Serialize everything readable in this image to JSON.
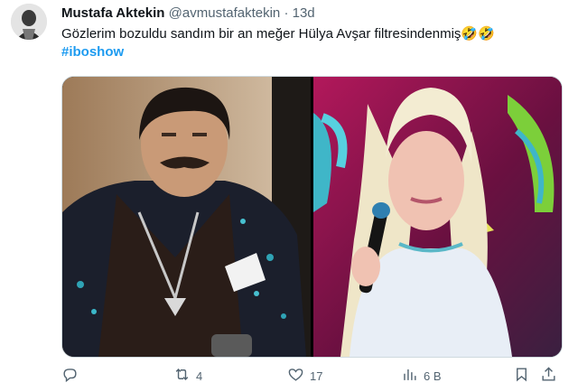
{
  "tweet": {
    "author_name": "Mustafa Aktekin",
    "handle": "@avmustafaktekin",
    "separator": "·",
    "time": "13d",
    "text": "Gözlerim bozuldu sandım bir an meğer Hülya Avşar filtresindenmiş🤣🤣",
    "hashtag": "#iboshow"
  },
  "media": {
    "left_image": "man-in-sequined-jacket",
    "right_image": "blonde-woman-holding-microphone"
  },
  "actions": {
    "reply_icon": "reply-icon",
    "retweet_icon": "retweet-icon",
    "retweet_count": "4",
    "like_icon": "heart-icon",
    "like_count": "17",
    "views_icon": "views-icon",
    "views_count": "6 B",
    "bookmark_icon": "bookmark-icon",
    "share_icon": "share-icon"
  },
  "colors": {
    "text": "#0f1419",
    "secondary": "#536471",
    "link": "#1d9bf0"
  }
}
